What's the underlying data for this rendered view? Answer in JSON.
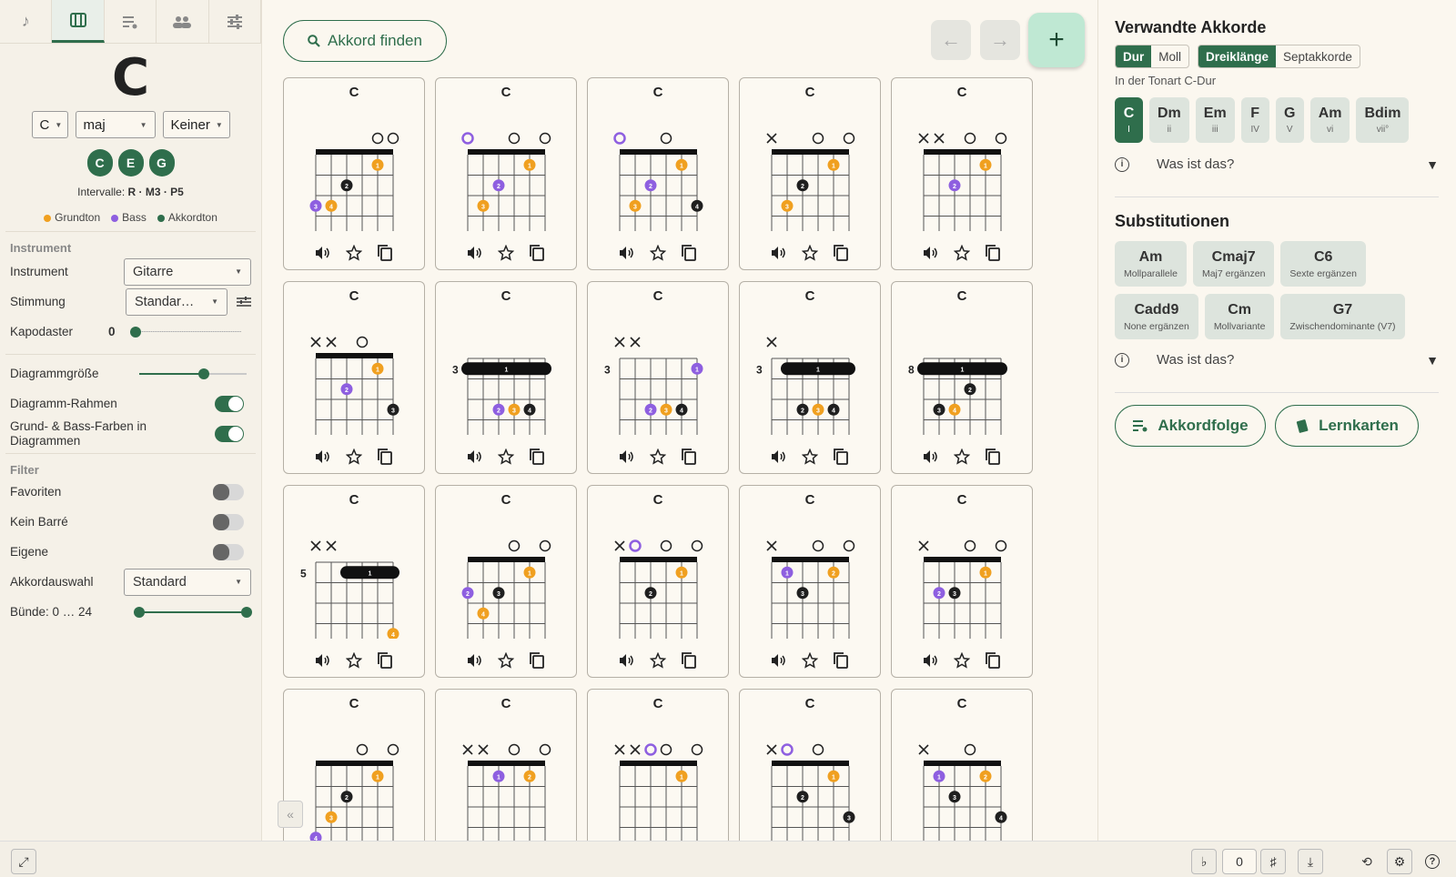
{
  "left": {
    "chord": "C",
    "root_select": "C",
    "quality_select": "maj",
    "bass_select": "Keiner",
    "notes": [
      "C",
      "E",
      "G"
    ],
    "intervals_label": "Intervalle:",
    "intervals_value": "R · M3 · P5",
    "legend": {
      "root": "Grundton",
      "bass": "Bass",
      "tone": "Akkordton"
    },
    "section_instrument": "Instrument",
    "instrument_label": "Instrument",
    "instrument_value": "Gitarre",
    "tuning_label": "Stimmung",
    "tuning_value": "Standar…",
    "capo_label": "Kapodaster",
    "capo_value": "0",
    "size_label": "Diagrammgröße",
    "size_level": 0.6,
    "frame_label": "Diagramm-Rahmen",
    "colors_label": "Grund- & Bass-Farben in Diagrammen",
    "section_filter": "Filter",
    "fav_label": "Favoriten",
    "nobarre_label": "Kein Barré",
    "own_label": "Eigene",
    "select_label": "Akkordauswahl",
    "select_value": "Standard",
    "frets_label": "Bünde: 0 … 24"
  },
  "main": {
    "search_label": "Akkord finden",
    "cards": [
      {
        "name": "C",
        "fret": null,
        "marks": [
          "",
          "",
          "",
          "",
          "o",
          "o"
        ],
        "dots": [
          [
            0,
            3,
            "b",
            3
          ],
          [
            1,
            3,
            "r",
            4
          ],
          [
            2,
            2,
            "t",
            2
          ],
          [
            4,
            1,
            "r",
            1
          ]
        ],
        "barre": null,
        "notes": [
          "G",
          "C",
          "E",
          "G",
          "C",
          "E"
        ]
      },
      {
        "name": "C",
        "fret": null,
        "marks": [
          "o",
          "",
          "",
          "o",
          "",
          "o"
        ],
        "dots": [
          [
            1,
            3,
            "r",
            3
          ],
          [
            2,
            2,
            "b",
            2
          ],
          [
            4,
            1,
            "r",
            1
          ]
        ],
        "barre": null,
        "notes": [
          "E",
          "C",
          "E",
          "G",
          "C",
          "E"
        ]
      },
      {
        "name": "C",
        "fret": null,
        "marks": [
          "o",
          "",
          "",
          "o",
          "",
          ""
        ],
        "dots": [
          [
            1,
            3,
            "r",
            3
          ],
          [
            2,
            2,
            "b",
            2
          ],
          [
            4,
            1,
            "r",
            1
          ],
          [
            5,
            3,
            "t",
            4
          ]
        ],
        "barre": null,
        "notes": [
          "E",
          "C",
          "E",
          "G",
          "C",
          "G"
        ]
      },
      {
        "name": "C",
        "fret": null,
        "marks": [
          "x",
          "",
          "",
          "o",
          "",
          "o"
        ],
        "dots": [
          [
            1,
            3,
            "r",
            3
          ],
          [
            2,
            2,
            "t",
            2
          ],
          [
            4,
            1,
            "r",
            1
          ]
        ],
        "barre": null,
        "notes": [
          "",
          "C",
          "E",
          "G",
          "C",
          "E"
        ]
      },
      {
        "name": "C",
        "fret": null,
        "marks": [
          "x",
          "x",
          "",
          "o",
          "",
          "o"
        ],
        "dots": [
          [
            2,
            2,
            "b",
            2
          ],
          [
            4,
            1,
            "r",
            1
          ]
        ],
        "barre": null,
        "notes": [
          "",
          "",
          "E",
          "G",
          "C",
          "E"
        ]
      },
      {
        "name": "C",
        "fret": null,
        "marks": [
          "x",
          "x",
          "",
          "o",
          "",
          ""
        ],
        "dots": [
          [
            2,
            2,
            "b",
            2
          ],
          [
            4,
            1,
            "r",
            1
          ],
          [
            5,
            3,
            "t",
            3
          ]
        ],
        "barre": null,
        "notes": [
          "",
          "",
          "E",
          "G",
          "C",
          "G"
        ]
      },
      {
        "name": "C",
        "fret": "3",
        "marks": [
          "",
          "",
          "",
          "",
          "",
          ""
        ],
        "dots": [
          [
            2,
            3,
            "b",
            2
          ],
          [
            3,
            3,
            "r",
            3
          ],
          [
            4,
            3,
            "t",
            4
          ]
        ],
        "barre": [
          0,
          5,
          1
        ],
        "notes": [
          "G",
          "C",
          "G",
          "C",
          "E",
          "G"
        ]
      },
      {
        "name": "C",
        "fret": "3",
        "marks": [
          "x",
          "x",
          "",
          "",
          "",
          ""
        ],
        "dots": [
          [
            5,
            1,
            "b",
            1
          ],
          [
            2,
            3,
            "b",
            2
          ],
          [
            3,
            3,
            "r",
            3
          ],
          [
            4,
            3,
            "t",
            4
          ]
        ],
        "barre": null,
        "notes": [
          "",
          "",
          "G",
          "C",
          "E",
          "G"
        ]
      },
      {
        "name": "C",
        "fret": "3",
        "marks": [
          "x",
          "",
          "",
          "",
          "",
          ""
        ],
        "dots": [
          [
            2,
            3,
            "t",
            2
          ],
          [
            3,
            3,
            "r",
            3
          ],
          [
            4,
            3,
            "t",
            4
          ]
        ],
        "barre": [
          1,
          5,
          1
        ],
        "notes": [
          "",
          "C",
          "G",
          "C",
          "E",
          "G"
        ]
      },
      {
        "name": "C",
        "fret": "8",
        "marks": [
          "",
          "",
          "",
          "",
          "",
          ""
        ],
        "dots": [
          [
            3,
            2,
            "t",
            2
          ],
          [
            1,
            3,
            "t",
            3
          ],
          [
            2,
            3,
            "r",
            4
          ]
        ],
        "barre": [
          0,
          5,
          1
        ],
        "notes": [
          "C",
          "G",
          "C",
          "E",
          "G",
          "C"
        ]
      },
      {
        "name": "C",
        "fret": "5",
        "marks": [
          "x",
          "x",
          "",
          "",
          "",
          ""
        ],
        "dots": [
          [
            5,
            4,
            "r",
            4
          ]
        ],
        "barre": [
          2,
          5,
          1
        ],
        "notes": [
          "",
          "",
          "G",
          "C",
          "E",
          "C"
        ]
      },
      {
        "name": "C",
        "fret": null,
        "marks": [
          "",
          "",
          "",
          "o",
          "",
          "o"
        ],
        "dots": [
          [
            0,
            2,
            "b",
            2
          ],
          [
            1,
            3,
            "r",
            4
          ],
          [
            2,
            2,
            "t",
            3
          ],
          [
            4,
            1,
            "r",
            1
          ]
        ],
        "barre": null,
        "notes": [
          "F#",
          "C",
          "E",
          "G",
          "C",
          "E"
        ]
      },
      {
        "name": "C",
        "fret": null,
        "marks": [
          "x",
          "o",
          "",
          "o",
          "",
          "o"
        ],
        "dots": [
          [
            2,
            2,
            "t",
            2
          ],
          [
            4,
            1,
            "r",
            1
          ]
        ],
        "barre": null,
        "notes": [
          "",
          "A",
          "E",
          "G",
          "C",
          "E"
        ]
      },
      {
        "name": "C",
        "fret": null,
        "marks": [
          "x",
          "",
          "",
          "o",
          "",
          "o"
        ],
        "dots": [
          [
            1,
            1,
            "b",
            1
          ],
          [
            2,
            2,
            "t",
            3
          ],
          [
            4,
            1,
            "r",
            2
          ]
        ],
        "barre": null,
        "notes": [
          "",
          "A#",
          "E",
          "G",
          "C",
          "E"
        ]
      },
      {
        "name": "C",
        "fret": null,
        "marks": [
          "x",
          "",
          "",
          "o",
          "",
          "o"
        ],
        "dots": [
          [
            1,
            2,
            "b",
            2
          ],
          [
            2,
            2,
            "t",
            3
          ],
          [
            4,
            1,
            "r",
            1
          ]
        ],
        "barre": null,
        "notes": [
          "",
          "B",
          "E",
          "G",
          "C",
          "E"
        ]
      },
      {
        "name": "C",
        "fret": null,
        "marks": [
          "",
          "",
          "",
          "o",
          "",
          "o"
        ],
        "dots": [
          [
            0,
            4,
            "b",
            4
          ],
          [
            1,
            3,
            "r",
            3
          ],
          [
            2,
            2,
            "t",
            2
          ],
          [
            4,
            1,
            "r",
            1
          ]
        ],
        "barre": null,
        "notes": [
          "G#",
          "C",
          "E",
          "G",
          "C",
          "E"
        ]
      },
      {
        "name": "C",
        "fret": null,
        "marks": [
          "x",
          "x",
          "",
          "o",
          "",
          "o"
        ],
        "dots": [
          [
            2,
            1,
            "b",
            1
          ],
          [
            4,
            1,
            "r",
            2
          ]
        ],
        "barre": null,
        "notes": [
          "",
          "",
          "D#",
          "G",
          "C",
          "E"
        ]
      },
      {
        "name": "C",
        "fret": null,
        "marks": [
          "x",
          "x",
          "o",
          "o",
          "",
          "o"
        ],
        "dots": [
          [
            4,
            1,
            "r",
            1
          ]
        ],
        "barre": null,
        "notes": [
          "",
          "",
          "D",
          "G",
          "C",
          "E"
        ]
      },
      {
        "name": "C",
        "fret": null,
        "marks": [
          "x",
          "o",
          "",
          "o",
          "",
          ""
        ],
        "dots": [
          [
            2,
            2,
            "t",
            2
          ],
          [
            4,
            1,
            "r",
            1
          ],
          [
            5,
            3,
            "t",
            3
          ]
        ],
        "barre": null,
        "notes": [
          "",
          "A",
          "E",
          "G",
          "C",
          "G"
        ]
      },
      {
        "name": "C",
        "fret": null,
        "marks": [
          "x",
          "",
          "",
          "o",
          "",
          ""
        ],
        "dots": [
          [
            1,
            1,
            "b",
            1
          ],
          [
            2,
            2,
            "t",
            3
          ],
          [
            4,
            1,
            "r",
            2
          ],
          [
            5,
            3,
            "t",
            4
          ]
        ],
        "barre": null,
        "notes": [
          "",
          "A#",
          "E",
          "G",
          "C",
          "G"
        ]
      }
    ]
  },
  "right": {
    "related_title": "Verwandte Akkorde",
    "seg_dur": "Dur",
    "seg_moll": "Moll",
    "seg_tri": "Dreiklänge",
    "seg_sept": "Septakkorde",
    "key_info": "In der Tonart C-Dur",
    "degrees": [
      {
        "chord": "C",
        "deg": "I"
      },
      {
        "chord": "Dm",
        "deg": "ii"
      },
      {
        "chord": "Em",
        "deg": "iii"
      },
      {
        "chord": "F",
        "deg": "IV"
      },
      {
        "chord": "G",
        "deg": "V"
      },
      {
        "chord": "Am",
        "deg": "vi"
      },
      {
        "chord": "Bdim",
        "deg": "vii°"
      }
    ],
    "whatis": "Was ist das?",
    "subs_title": "Substitutionen",
    "subs_row1": [
      {
        "chord": "Am",
        "desc": "Mollparallele"
      },
      {
        "chord": "Cmaj7",
        "desc": "Maj7 ergänzen"
      },
      {
        "chord": "C6",
        "desc": "Sexte ergänzen"
      }
    ],
    "subs_row2": [
      {
        "chord": "Cadd9",
        "desc": "None ergänzen"
      },
      {
        "chord": "Cm",
        "desc": "Mollvariante"
      },
      {
        "chord": "G7",
        "desc": "Zwischendominante (V7)"
      }
    ],
    "progression_button": "Akkordfolge",
    "flashcards_button": "Lernkarten"
  },
  "bottom": {
    "transpose_value": "0",
    "flat": "♭",
    "sharp": "♯"
  },
  "colors": {
    "root": "#f0a020",
    "bass": "#8e5fe0",
    "tone": "#1f1f1f",
    "accent": "#2f6e4c"
  }
}
